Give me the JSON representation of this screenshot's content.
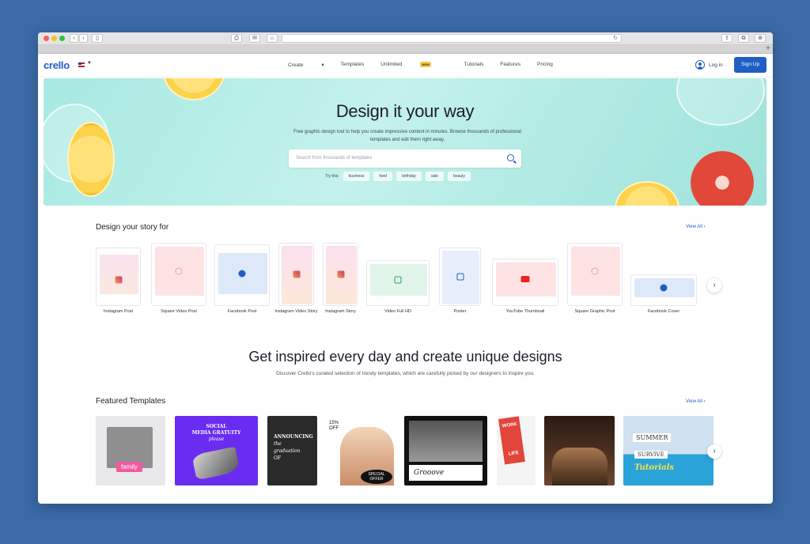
{
  "brand": {
    "logo": "crello",
    "accent": "#1f5fc4"
  },
  "nav": {
    "links": [
      "Create",
      "Templates",
      "Unlimited",
      "Tutorials",
      "Features",
      "Pricing"
    ],
    "new_badge": "NEW",
    "login": "Log in",
    "signup": "Sign Up"
  },
  "hero": {
    "title": "Design it your way",
    "subtitle": "Free graphic design tool to help you create impressive content in minutes. Browse thousands of professional templates and edit them right away.",
    "search_placeholder": "Search from thousands of templates",
    "try_label": "Try this:",
    "chips": [
      "business",
      "food",
      "birthday",
      "sale",
      "beauty"
    ]
  },
  "story": {
    "title": "Design your story for",
    "view_all": "View All",
    "formats": [
      {
        "label": "Instagram Post",
        "icon": "instagram-icon"
      },
      {
        "label": "Square Video Post",
        "icon": "refresh-icon"
      },
      {
        "label": "Facebook Post",
        "icon": "facebook-icon"
      },
      {
        "label": "Instagram Video Story",
        "icon": "instagram-icon"
      },
      {
        "label": "Instagram Story",
        "icon": "instagram-icon"
      },
      {
        "label": "Video Full HD",
        "icon": "play-icon"
      },
      {
        "label": "Poster",
        "icon": "poster-icon"
      },
      {
        "label": "YouTube Thumbnail",
        "icon": "youtube-icon"
      },
      {
        "label": "Square Graphic Post",
        "icon": "refresh-icon"
      },
      {
        "label": "Facebook Cover",
        "icon": "facebook-icon"
      }
    ]
  },
  "inspire": {
    "title": "Get inspired every day and create unique designs",
    "subtitle": "Discover Crello's curated selection of trendy templates, which are carefully picked by our designers to inspire you."
  },
  "featured": {
    "title": "Featured Templates",
    "view_all": "View All",
    "t1": "family",
    "t2_line1": "SOCIAL",
    "t2_line2": "MEDIA GRATUITY",
    "t2_line3": "please",
    "t3_line1": "ANNOUNCING",
    "t3_line2": "the",
    "t3_line3": "graduation",
    "t3_line4": "OF",
    "t4_line1": "15%",
    "t4_line2": "OFF",
    "t4_line3": "SPECIAL",
    "t4_line4": "OFFER",
    "t5": "Grooove",
    "t6_line1": "WORK",
    "t6_line2": "LIFE",
    "t8_line1": "SUMMER",
    "t8_line2": "SURVIVE",
    "t8_line3": "Tutorials"
  }
}
